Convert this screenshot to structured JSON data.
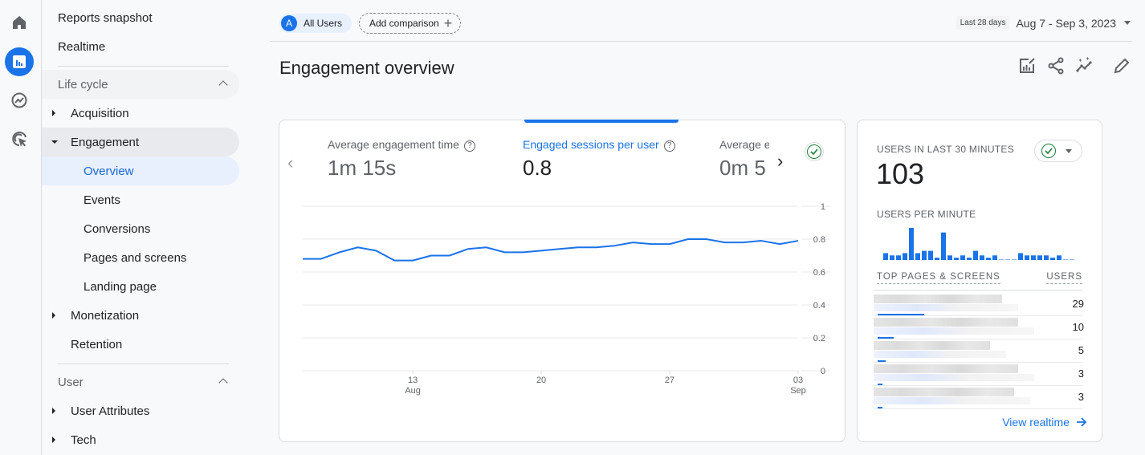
{
  "rail": {
    "items": [
      {
        "name": "home",
        "icon": "home-icon"
      },
      {
        "name": "reports",
        "icon": "bar-chart-icon",
        "active": true
      },
      {
        "name": "explore",
        "icon": "explore-icon"
      },
      {
        "name": "advertising",
        "icon": "advertising-icon"
      }
    ]
  },
  "nav": {
    "reports_snapshot": "Reports snapshot",
    "realtime": "Realtime",
    "lifecycle": {
      "label": "Life cycle",
      "acquisition": "Acquisition",
      "engagement": "Engagement",
      "engagement_children": [
        "Overview",
        "Events",
        "Conversions",
        "Pages and screens",
        "Landing page"
      ],
      "monetization": "Monetization",
      "retention": "Retention"
    },
    "user": {
      "label": "User",
      "user_attributes": "User Attributes",
      "tech": "Tech"
    }
  },
  "header": {
    "segment_avatar": "A",
    "segment_label": "All Users",
    "add_comparison": "Add comparison",
    "date_preset": "Last 28 days",
    "date_range": "Aug 7 - Sep 3, 2023"
  },
  "page": {
    "title": "Engagement overview",
    "tools": [
      "customize-report-icon",
      "share-icon",
      "insights-icon",
      "edit-icon"
    ]
  },
  "metrics": [
    {
      "label": "Average engagement time",
      "value": "1m 15s",
      "active": false
    },
    {
      "label": "Engaged sessions per user",
      "value": "0.8",
      "active": true
    },
    {
      "label": "Average e",
      "value": "0m 5",
      "active": false
    }
  ],
  "chart_data": [
    {
      "type": "line",
      "title": "Engaged sessions per user",
      "x": [
        "Aug 7",
        "Aug 8",
        "Aug 9",
        "Aug 10",
        "Aug 11",
        "Aug 12",
        "Aug 13",
        "Aug 14",
        "Aug 15",
        "Aug 16",
        "Aug 17",
        "Aug 18",
        "Aug 19",
        "Aug 20",
        "Aug 21",
        "Aug 22",
        "Aug 23",
        "Aug 24",
        "Aug 25",
        "Aug 26",
        "Aug 27",
        "Aug 28",
        "Aug 29",
        "Aug 30",
        "Aug 31",
        "Sep 1",
        "Sep 2",
        "Sep 3"
      ],
      "series": [
        {
          "name": "Engaged sessions per user",
          "color": "#1a73e8",
          "values": [
            0.68,
            0.68,
            0.72,
            0.75,
            0.73,
            0.67,
            0.67,
            0.7,
            0.7,
            0.74,
            0.75,
            0.72,
            0.72,
            0.73,
            0.74,
            0.75,
            0.75,
            0.76,
            0.78,
            0.77,
            0.77,
            0.8,
            0.8,
            0.78,
            0.78,
            0.79,
            0.77,
            0.79
          ]
        }
      ],
      "x_ticks": [
        {
          "index": 6,
          "label": "13",
          "sub": "Aug"
        },
        {
          "index": 13,
          "label": "20",
          "sub": ""
        },
        {
          "index": 20,
          "label": "27",
          "sub": ""
        },
        {
          "index": 27,
          "label": "03",
          "sub": "Sep"
        }
      ],
      "y_ticks": [
        "0",
        "0.2",
        "0.4",
        "0.6",
        "0.8",
        "1"
      ],
      "ylim": [
        0,
        1
      ],
      "grid": true,
      "y_axis_side": "right"
    },
    {
      "type": "bar",
      "title": "USERS PER MINUTE",
      "values": [
        3,
        2,
        2,
        3,
        14,
        3,
        4,
        4,
        1,
        12,
        2,
        1,
        2,
        1,
        4,
        2,
        1,
        2,
        0.3,
        0.3,
        0.3,
        3,
        2,
        2,
        2,
        2,
        1,
        2,
        0.3,
        0.3
      ],
      "color": "#1a73e8"
    }
  ],
  "realtime": {
    "title": "USERS IN LAST 30 MINUTES",
    "count": "103",
    "per_minute_label": "USERS PER MINUTE",
    "table_header_left": "TOP PAGES & SCREENS",
    "table_header_right": "USERS",
    "rows": [
      {
        "users": "29",
        "share": 1.0
      },
      {
        "users": "10",
        "share": 0.34
      },
      {
        "users": "5",
        "share": 0.17
      },
      {
        "users": "3",
        "share": 0.05
      },
      {
        "users": "3",
        "share": 0.05
      }
    ],
    "view_link": "View realtime"
  }
}
